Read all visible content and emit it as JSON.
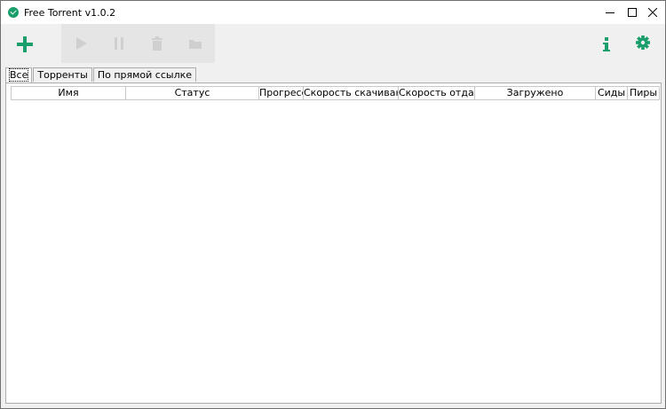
{
  "window": {
    "title": "Free Torrent v1.0.2"
  },
  "icons": {
    "app": "download-circle-icon",
    "minimize": "minimize-icon",
    "maximize": "maximize-icon",
    "close": "close-icon",
    "add": "plus-icon",
    "start": "play-icon",
    "pause": "pause-icon",
    "delete": "trash-icon",
    "open_folder": "folder-icon",
    "info": "info-icon",
    "settings": "gear-icon"
  },
  "colors": {
    "accent": "#1a9e6b",
    "disabled_icon": "#cfcfcf"
  },
  "tabs": [
    {
      "label": "Все"
    },
    {
      "label": "Торренты"
    },
    {
      "label": "По прямой ссылке"
    }
  ],
  "table": {
    "columns": [
      "Имя",
      "Статус",
      "Прогресс",
      "Скорость скачивания",
      "Скорость отдачи",
      "Загружено",
      "Сиды",
      "Пиры"
    ],
    "rows": []
  }
}
